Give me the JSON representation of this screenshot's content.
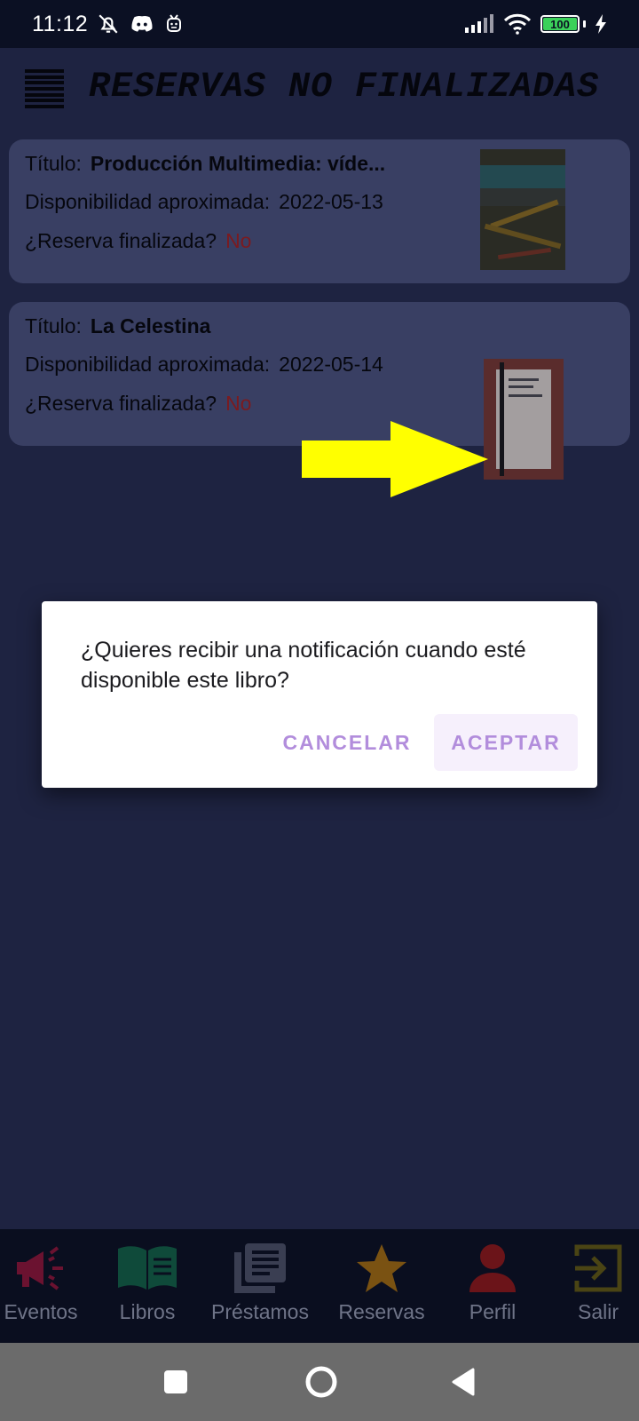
{
  "status_bar": {
    "time": "11:12",
    "battery_level": "100",
    "icons": [
      "bell-off-icon",
      "discord-icon",
      "robot-icon",
      "signal-icon",
      "wifi-icon",
      "charging-icon"
    ]
  },
  "header": {
    "title": "RESERVAS NO FINALIZADAS",
    "menu_icon": "hamburger-menu-icon"
  },
  "reservations": [
    {
      "title_label": "Título:",
      "title": "Producción Multimedia: víde...",
      "availability_label": "Disponibilidad aproximada:",
      "availability_date": "2022-05-13",
      "finished_label": "¿Reserva finalizada?",
      "finished_value": "No"
    },
    {
      "title_label": "Título:",
      "title": "La Celestina",
      "availability_label": "Disponibilidad aproximada:",
      "availability_date": "2022-05-14",
      "finished_label": "¿Reserva finalizada?",
      "finished_value": "No"
    }
  ],
  "dialog": {
    "message": "¿Quieres recibir una notificación cuando esté disponible este libro?",
    "cancel_label": "CANCELAR",
    "accept_label": "ACEPTAR"
  },
  "bottom_nav": [
    {
      "label": "Eventos",
      "icon": "megaphone-icon",
      "color": "#6b1230"
    },
    {
      "label": "Libros",
      "icon": "book-icon",
      "color": "#0f4a3a"
    },
    {
      "label": "Préstamos",
      "icon": "library-icon",
      "color": "#3a3e52"
    },
    {
      "label": "Reservas",
      "icon": "star-icon",
      "color": "#7a5212"
    },
    {
      "label": "Perfil",
      "icon": "person-icon",
      "color": "#6b1419"
    },
    {
      "label": "Salir",
      "icon": "exit-icon",
      "color": "#4a4414"
    }
  ],
  "colors": {
    "background": "#1e2341",
    "card": "#393f63",
    "accent": "#b28ddc",
    "no_value": "#7b1a1f",
    "arrow": "#ffff00"
  }
}
